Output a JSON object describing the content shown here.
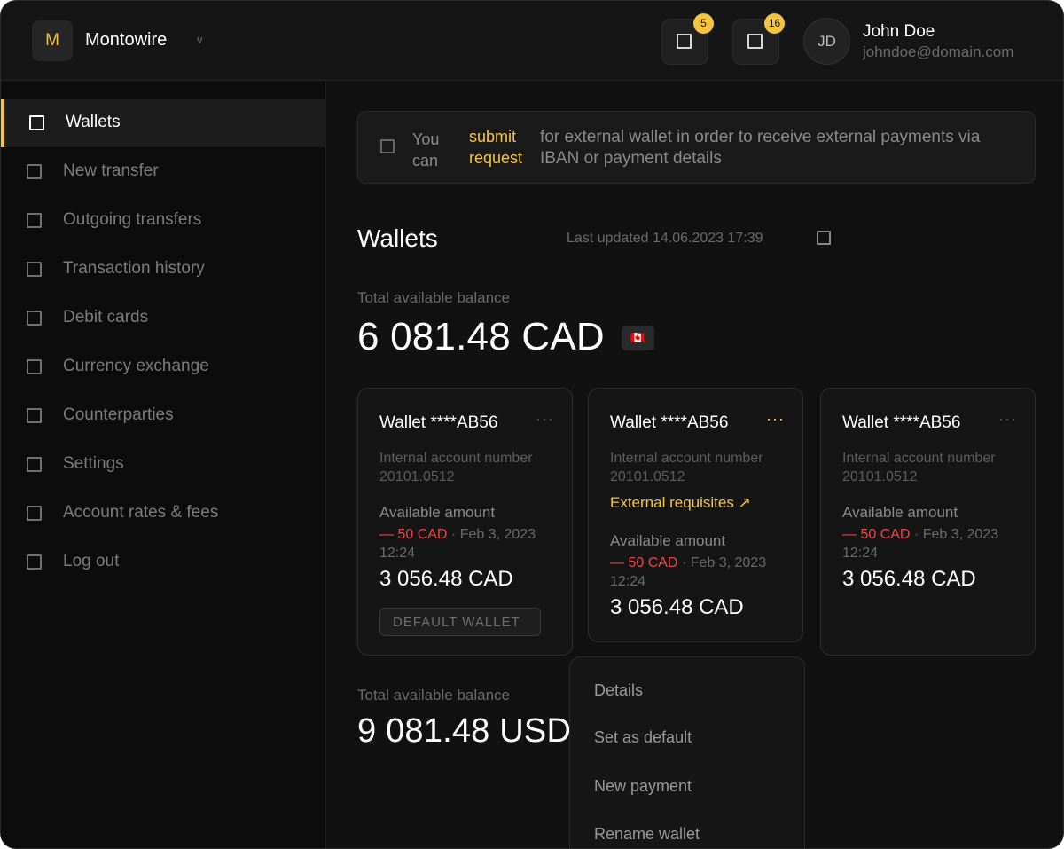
{
  "header": {
    "logo_letter": "M",
    "company_name": "Montowire",
    "company_chevron": "v",
    "notifications": [
      {
        "icon": "bell-icon",
        "count": "5"
      },
      {
        "icon": "message-icon",
        "count": "16"
      }
    ],
    "user": {
      "initials": "JD",
      "name": "John Doe",
      "email": "johndoe@domain.com"
    }
  },
  "sidebar": {
    "items": [
      {
        "label": "Wallets",
        "active": true
      },
      {
        "label": "New transfer"
      },
      {
        "label": "Outgoing transfers"
      },
      {
        "label": "Transaction history"
      },
      {
        "label": "Debit cards"
      },
      {
        "label": "Currency exchange"
      },
      {
        "label": "Counterparties"
      },
      {
        "label": "Settings"
      },
      {
        "label": "Account rates & fees"
      },
      {
        "label": "Log out"
      }
    ]
  },
  "banner": {
    "prefix": "You can",
    "link": "submit request",
    "rest": "for external wallet in order to receive external payments via IBAN or payment details"
  },
  "main": {
    "title": "Wallets",
    "last_updated": "Last updated 14.06.2023 17:39",
    "balances": [
      {
        "label": "Total available balance",
        "value": "6 081.48 CAD",
        "flag": "🇨🇦"
      },
      {
        "label": "Total available balance",
        "value": "9 081.48 USD"
      }
    ],
    "wallets": [
      {
        "title": "Wallet ****AB56",
        "menu": "···",
        "account": "Internal account number 20101.0512",
        "available_label": "Available amount",
        "tx_amount": "— 50 CAD",
        "tx_date": " · Feb 3, 2023 12:24",
        "amount": "3 056.48 CAD",
        "default_label": "DEFAULT WALLET"
      },
      {
        "title": "Wallet ****AB56",
        "menu": "···",
        "account": "Internal account number 20101.0512",
        "external": "External requisites ↗",
        "available_label": "Available amount",
        "tx_amount": "— 50 CAD",
        "tx_date": " · Feb 3, 2023 12:24",
        "amount": "3 056.48 CAD"
      },
      {
        "title": "Wallet ****AB56",
        "menu": "···",
        "account": "Internal account number 20101.0512",
        "available_label": "Available amount",
        "tx_amount": "— 50 CAD",
        "tx_date": " · Feb 3, 2023 12:24",
        "amount": "3 056.48 CAD"
      }
    ],
    "wallet_menu": [
      "Details",
      "Set as default",
      "New payment",
      "Rename wallet"
    ]
  },
  "colors": {
    "accent": "#f5c542",
    "negative": "#e5484d",
    "background": "#111111"
  }
}
